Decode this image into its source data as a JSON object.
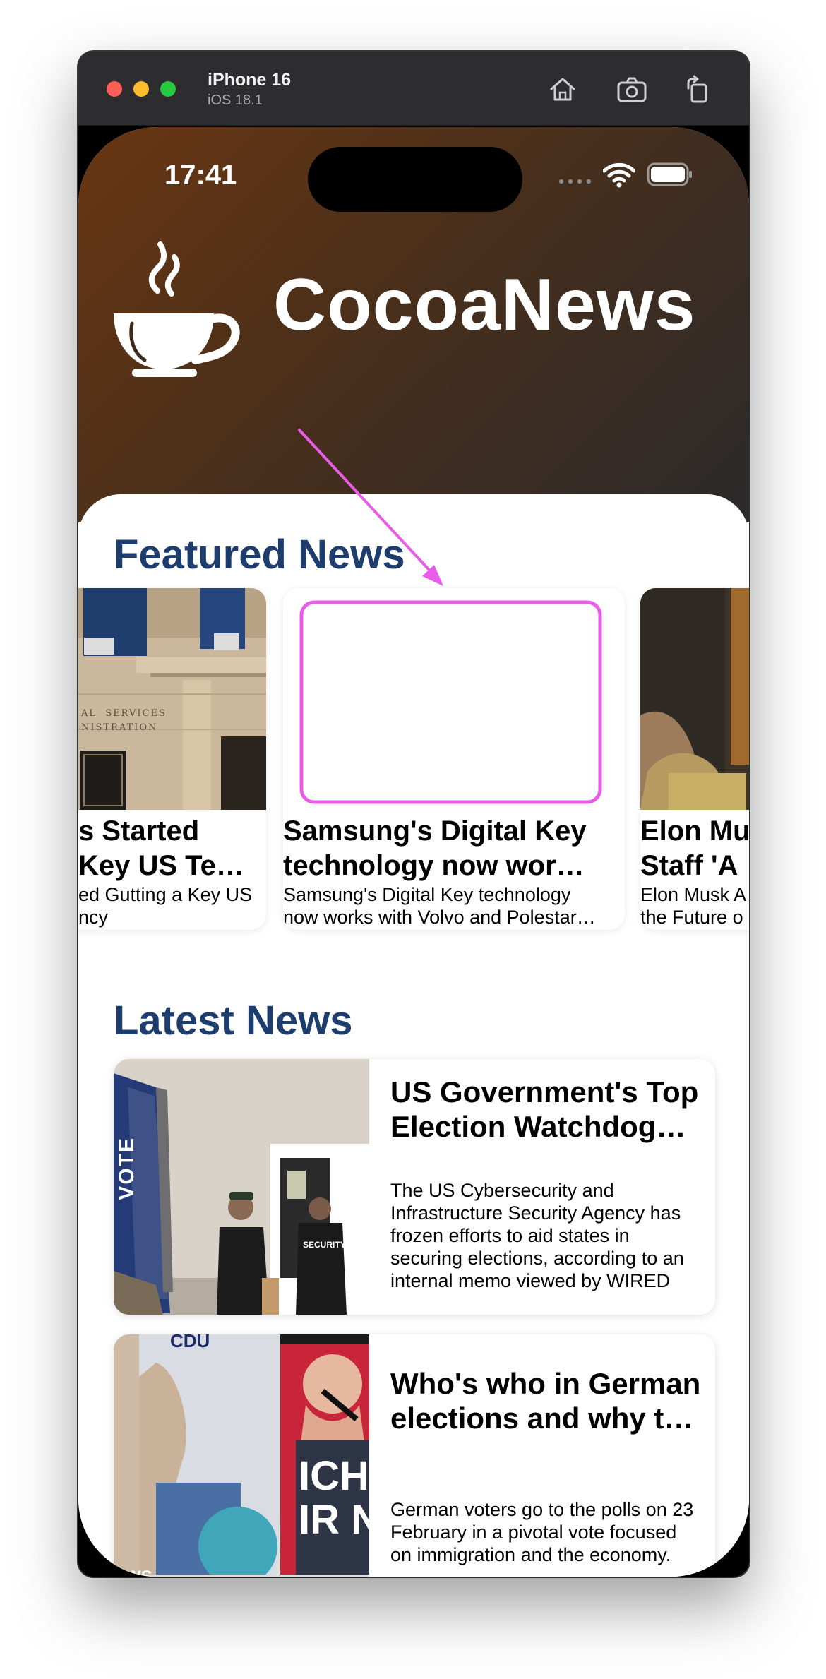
{
  "simulator": {
    "device_name": "iPhone 16",
    "os_version": "iOS 18.1",
    "toolbar_icons": [
      "home-icon",
      "screenshot-icon",
      "rotate-icon"
    ]
  },
  "status_bar": {
    "time": "17:41"
  },
  "app": {
    "title": "CocoaNews",
    "logo_icon": "coffee-cup-icon"
  },
  "featured": {
    "section_title": "Featured News",
    "cards": [
      {
        "title": "s Started\nKey US Te…",
        "description": "ed Gutting a Key US\nncy",
        "sign_text": "AL  SERVICES\nNISTRATION"
      },
      {
        "title": "Samsung's Digital Key\ntechnology now wor…",
        "description": "Samsung's Digital Key technology\nnow works with Volvo and Polestar…",
        "highlighted": true
      },
      {
        "title": "Elon Mu\nStaff 'A",
        "description": "Elon Musk A\nthe Future o"
      }
    ]
  },
  "latest": {
    "section_title": "Latest News",
    "items": [
      {
        "title": "US Government's Top\nElection Watchdog…",
        "description": "The US Cybersecurity and\nInfrastructure Security Agency has\nfrozen efforts to aid states in\nsecuring elections, according to an\ninternal memo viewed by WIRED",
        "flag_text": "VOTE",
        "jacket_text": "SECURITY"
      },
      {
        "title": "Who's who in German\nelections and why t…",
        "description": "German voters go to the polls on 23\nFebruary in a pivotal vote focused\non immigration and the economy.",
        "poster_text": "ICHE\nIR N",
        "masthead_text": "CDU",
        "corner_text": "EWS"
      }
    ]
  },
  "annotation": {
    "color": "#e85ce8"
  },
  "colors": {
    "heading": "#1c3d6e",
    "hero_start": "#6a3612",
    "hero_end": "#2b2a2c"
  }
}
